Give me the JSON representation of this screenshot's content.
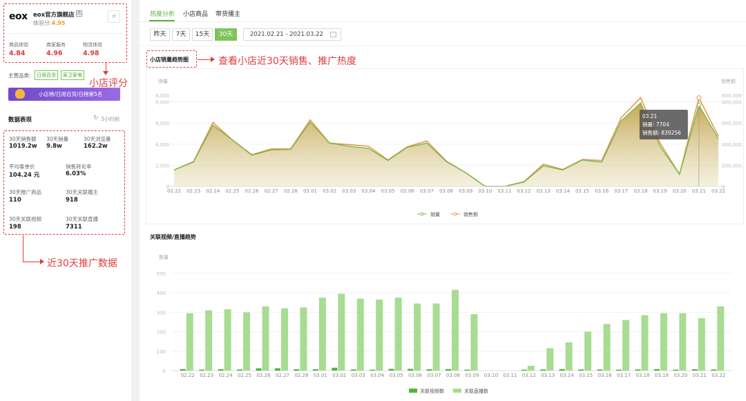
{
  "shop": {
    "logo": "eox",
    "name": "eox官方旗舰店",
    "score_label": "体验分:",
    "score": "4.95",
    "ratings": [
      {
        "label": "商品体验",
        "value": "4.84"
      },
      {
        "label": "商家服务",
        "value": "4.96"
      },
      {
        "label": "物流体验",
        "value": "4.98"
      }
    ],
    "category_label": "主营品类:",
    "categories": [
      "日用百货",
      "家卫家电"
    ],
    "rank_text": "小店榜/日用百货/日榜第5名"
  },
  "data_section": {
    "title": "数据表现",
    "updated": "3小时前",
    "stats": [
      {
        "label": "30天销售额",
        "value": "1019.2w"
      },
      {
        "label": "30天销量",
        "value": "9.8w"
      },
      {
        "label": "30天浏览量",
        "value": "162.2w"
      },
      {
        "label": "平均客单价",
        "value": "104.24 元"
      },
      {
        "label": "销售转化率",
        "value": "6.03%"
      },
      {
        "label": "30天推广商品",
        "value": "110"
      },
      {
        "label": "30天关联播主",
        "value": "918"
      },
      {
        "label": "30天关联视频",
        "value": "198"
      },
      {
        "label": "30天关联直播",
        "value": "7311"
      }
    ]
  },
  "annotations": {
    "score": "小店评分",
    "trend": "查看小店近30天销售、推广热度",
    "promo": "近30天推广数据"
  },
  "tabs": [
    "热度分析",
    "小店商品",
    "带货播主"
  ],
  "range": {
    "buttons": [
      "昨天",
      "7天",
      "15天",
      "30天"
    ],
    "active": "30天",
    "dates": "2021.02.21 - 2021.03.22"
  },
  "colors": {
    "accent": "#7ec45a",
    "sales_line": "#6cbf4e",
    "amount_line": "#f0924e",
    "bar_video": "#52b43a",
    "bar_live": "#a8dc92",
    "annot": "#e23b3b"
  },
  "chart_data": [
    {
      "type": "area",
      "title": "小店销量趋势图",
      "y_left_label": "销量",
      "y_right_label": "销售额",
      "x": [
        "02.22",
        "02.23",
        "02.24",
        "02.25",
        "02.26",
        "02.27",
        "02.28",
        "03.01",
        "03.02",
        "03.03",
        "03.04",
        "03.05",
        "03.06",
        "03.07",
        "03.08",
        "03.09",
        "03.10",
        "03.11",
        "03.12",
        "03.13",
        "03.14",
        "03.15",
        "03.16",
        "03.17",
        "03.18",
        "03.19",
        "03.20",
        "03.21",
        "03.22"
      ],
      "y_left_ticks": [
        "0",
        "2,000",
        "4,000",
        "6,000",
        "8,000",
        "8,500"
      ],
      "y_right_ticks": [
        "0",
        "200,000",
        "400,000",
        "600,000",
        "800,000",
        "850,000"
      ],
      "ylim": [
        0,
        8500
      ],
      "series": [
        {
          "name": "销量",
          "values": [
            1550,
            2300,
            5800,
            4400,
            2950,
            3450,
            3500,
            6100,
            4100,
            3800,
            3600,
            2450,
            3700,
            4100,
            2350,
            1300,
            0,
            0,
            400,
            1950,
            1550,
            2500,
            2300,
            6200,
            7900,
            3800,
            1150,
            7704,
            4500
          ]
        },
        {
          "name": "销售额",
          "values": [
            155000,
            235000,
            605000,
            440000,
            300000,
            355000,
            355000,
            630000,
            410000,
            395000,
            380000,
            250000,
            375000,
            430000,
            240000,
            130000,
            0,
            0,
            45000,
            210000,
            160000,
            255000,
            245000,
            650000,
            840000,
            410000,
            115000,
            839256,
            475000
          ]
        }
      ],
      "tooltip": {
        "date": "03.21",
        "sales_label": "销量:",
        "sales": "7704",
        "amount_label": "销售额:",
        "amount": "839256"
      },
      "legend": [
        "销量",
        "销售额"
      ]
    },
    {
      "type": "bar",
      "title": "关联视频/直播趋势",
      "y_label": "数量",
      "x": [
        "02.22",
        "02.23",
        "02.24",
        "02.25",
        "02.26",
        "02.27",
        "02.28",
        "03.01",
        "03.02",
        "03.03",
        "03.04",
        "03.05",
        "03.06",
        "03.07",
        "03.08",
        "03.09",
        "03.10",
        "03.11",
        "03.12",
        "03.13",
        "03.14",
        "03.15",
        "03.16",
        "03.17",
        "03.18",
        "03.19",
        "03.20",
        "03.21",
        "03.22"
      ],
      "y_ticks": [
        "0",
        "100",
        "200",
        "300",
        "400",
        "500"
      ],
      "ylim": [
        0,
        500
      ],
      "series": [
        {
          "name": "关联视频数",
          "values": [
            8,
            5,
            7,
            6,
            12,
            12,
            7,
            7,
            15,
            6,
            5,
            9,
            9,
            7,
            8,
            5,
            0,
            0,
            5,
            6,
            8,
            6,
            6,
            5,
            6,
            8,
            5,
            7,
            6
          ]
        },
        {
          "name": "关联直播数",
          "values": [
            295,
            310,
            315,
            300,
            330,
            320,
            325,
            375,
            395,
            370,
            365,
            375,
            345,
            345,
            415,
            290,
            0,
            0,
            25,
            115,
            145,
            200,
            240,
            260,
            285,
            295,
            295,
            270,
            330
          ]
        }
      ]
    }
  ]
}
